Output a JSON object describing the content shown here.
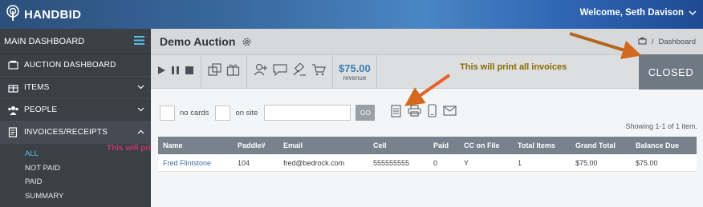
{
  "header": {
    "brand": "HANDBID",
    "welcome": "Welcome, Seth Davison"
  },
  "sidebar": {
    "title": "MAIN DASHBOARD",
    "items": [
      {
        "label": "AUCTION DASHBOARD",
        "icon": "auction-icon"
      },
      {
        "label": "ITEMS",
        "icon": "gift-icon"
      },
      {
        "label": "PEOPLE",
        "icon": "people-icon"
      },
      {
        "label": "INVOICES/RECEIPTS",
        "icon": "receipt-icon"
      }
    ],
    "subitems": [
      "ALL",
      "NOT PAID",
      "PAID",
      "SUMMARY"
    ],
    "annotation": "This will print all invoices"
  },
  "page": {
    "title": "Demo Auction",
    "breadcrumb": "Dashboard"
  },
  "toolbar": {
    "revenue_amount": "$75.00",
    "revenue_label": "revenue",
    "status": "CLOSED",
    "annotation": "This will print all invoices"
  },
  "filters": {
    "no_cards": "no cards",
    "on_site": "on site",
    "search_placeholder": "",
    "go": "GO"
  },
  "summary": "Showing 1-1 of 1 item.",
  "table": {
    "headers": [
      "Name",
      "Paddle#",
      "Email",
      "Cell",
      "Paid",
      "CC on File",
      "Total Items",
      "Grand Total",
      "Balance Due"
    ],
    "rows": [
      [
        "Fred Flintstone",
        "104",
        "fred@bedrock.com",
        "555555555",
        "0",
        "Y",
        "1",
        "$75.00",
        "$75.00"
      ]
    ]
  },
  "colors": {
    "accent": "#3d7fb5",
    "sidebar_bg": "#3a4046",
    "active_subitem": "#5bbce4",
    "closed_bg": "#6f7983",
    "arrow": "#d2691e"
  }
}
